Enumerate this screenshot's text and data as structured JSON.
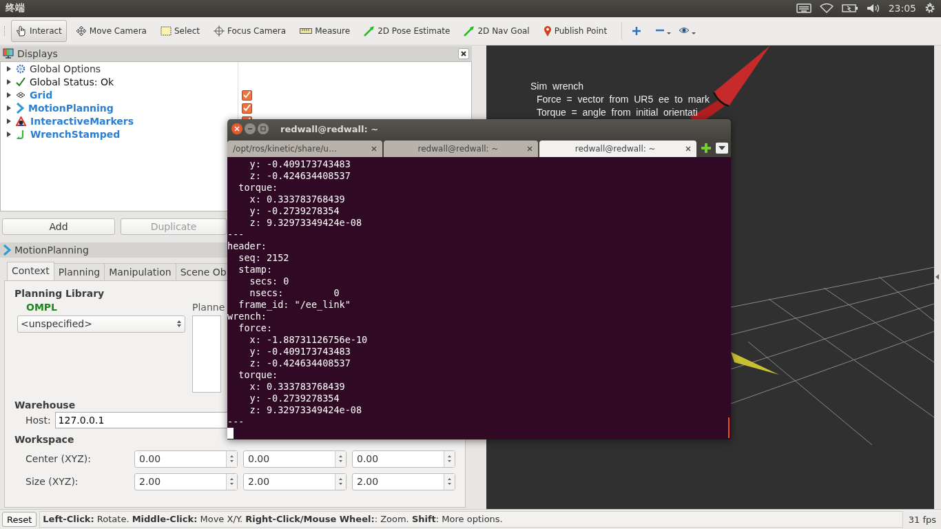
{
  "top_bar": {
    "title": "终端",
    "time": "23:05"
  },
  "toolbar": {
    "tools": [
      {
        "label": "Interact",
        "selected": true
      },
      {
        "label": "Move Camera",
        "selected": false
      },
      {
        "label": "Select",
        "selected": false
      },
      {
        "label": "Focus Camera",
        "selected": false
      },
      {
        "label": "Measure",
        "selected": false
      },
      {
        "label": "2D Pose Estimate",
        "selected": false
      },
      {
        "label": "2D Nav Goal",
        "selected": false
      },
      {
        "label": "Publish Point",
        "selected": false
      }
    ]
  },
  "displays": {
    "title": "Displays",
    "items": [
      {
        "label": "Global Options",
        "kind": "plain"
      },
      {
        "label": "Global Status: Ok",
        "kind": "status"
      },
      {
        "label": "Grid",
        "kind": "display",
        "checked": true
      },
      {
        "label": "MotionPlanning",
        "kind": "display",
        "checked": true
      },
      {
        "label": "InteractiveMarkers",
        "kind": "display",
        "checked": true
      },
      {
        "label": "WrenchStamped",
        "kind": "display"
      }
    ],
    "buttons": [
      {
        "label": "Add",
        "disabled": false
      },
      {
        "label": "Duplicate",
        "disabled": true
      }
    ]
  },
  "motion_planning": {
    "title": "MotionPlanning",
    "tabs": [
      {
        "label": "Context",
        "selected": true
      },
      {
        "label": "Planning",
        "selected": false
      },
      {
        "label": "Manipulation",
        "selected": false
      },
      {
        "label": "Scene Ob",
        "selected": false
      }
    ],
    "planning_library": {
      "heading": "Planning Library",
      "library": "OMPL",
      "planner": "<unspecified>",
      "planner_label": "Planne"
    },
    "warehouse": {
      "heading": "Warehouse",
      "host_label": "Host:",
      "host": "127.0.0.1"
    },
    "workspace": {
      "heading": "Workspace",
      "rows": [
        {
          "label": "Center (XYZ):",
          "values": [
            "0.00",
            "0.00",
            "0.00"
          ]
        },
        {
          "label": "Size (XYZ):",
          "values": [
            "2.00",
            "2.00",
            "2.00"
          ]
        }
      ]
    }
  },
  "view": {
    "overlay_lines": [
      "Sim  wrench",
      "Force  =  vector  from  UR5  ee  to  mark",
      "Torque  =  angle  from  initial  orientati"
    ]
  },
  "terminal": {
    "title": "redwall@redwall: ~",
    "tabs": [
      {
        "label": "/opt/ros/kinetic/share/u…",
        "selected": false
      },
      {
        "label": "redwall@redwall: ~",
        "selected": false
      },
      {
        "label": "redwall@redwall: ~",
        "selected": true
      }
    ],
    "lines": [
      "    y: -0.409173743483",
      "    z: -0.424634408537",
      "  torque:",
      "    x: 0.333783768439",
      "    y: -0.2739278354",
      "    z: 9.32973349424e-08",
      "---",
      "header:",
      "  seq: 2152",
      "  stamp:",
      "    secs: 0",
      "    nsecs:         0",
      "  frame_id: \"/ee_link\"",
      "wrench:",
      "  force:",
      "    x: -1.88731126756e-10",
      "    y: -0.409173743483",
      "    z: -0.424634408537",
      "  torque:",
      "    x: 0.333783768439",
      "    y: -0.2739278354",
      "    z: 9.32973349424e-08",
      "---"
    ]
  },
  "status_bar": {
    "reset": "Reset",
    "message": "**Left-Click:** Rotate. **Middle-Click:** Move X/Y. **Right-Click/Mouse Wheel:**: Zoom. **Shift**: More options.",
    "fps": "31 fps"
  }
}
